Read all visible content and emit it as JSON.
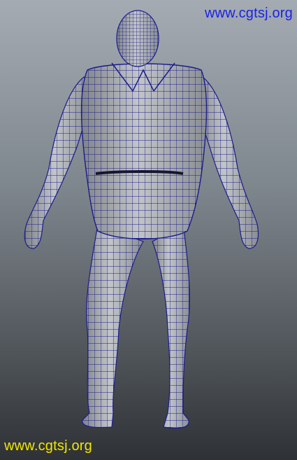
{
  "viewport": {
    "background_top": "#a4abb2",
    "background_bottom": "#2e3135"
  },
  "watermark_top": {
    "text": "www.cgtsj.org",
    "color": "#1a22e8"
  },
  "watermark_bottom": {
    "text": "www.cgtsj.org",
    "color": "#f2e600"
  },
  "model": {
    "icon": "wireframe-character-model",
    "shading_color": "#b6b9bd",
    "wire_color": "#1c1c8c"
  }
}
